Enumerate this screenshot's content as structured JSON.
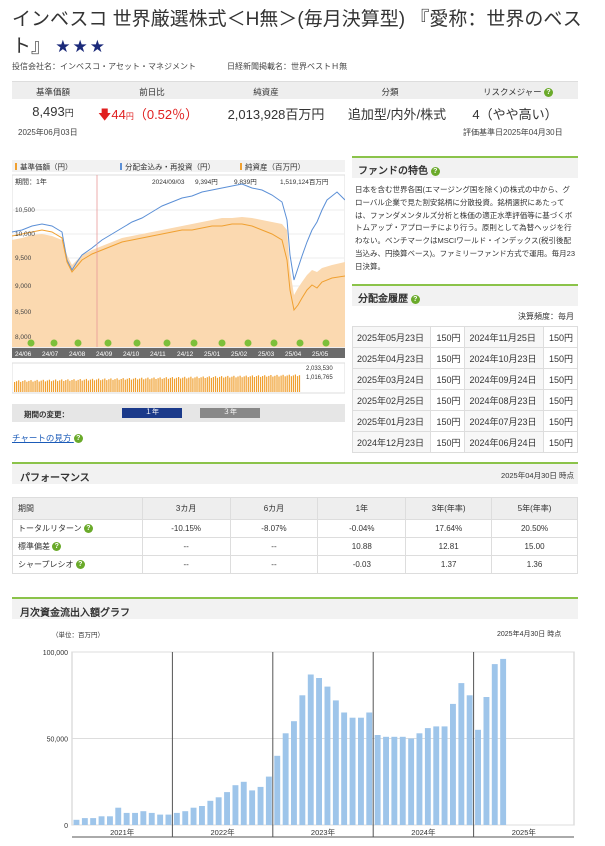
{
  "fund": {
    "title": "インベスコ 世界厳選株式＜H無＞(毎月決算型) 『愛称：世界のベスト』",
    "stars": "★★★",
    "company": "投信会社名：インベスコ・アセット・マネジメント",
    "nikkei_name": "日経新聞掲載名：世界ベストＨ無"
  },
  "summary": {
    "headers": [
      "基準価額",
      "前日比",
      "純資産",
      "分類",
      "リスクメジャー"
    ],
    "nav": "8,493",
    "nav_unit": "円",
    "change": "44",
    "change_unit": "円",
    "change_pct": "（0.52％）",
    "assets": "2,013,928百万円",
    "category": "追加型/内外/株式",
    "risk": "4（やや高い）",
    "nav_date": "2025年06月03日",
    "risk_date": "評価基準日2025年04月30日"
  },
  "price_chart": {
    "legend": [
      "基準価額（円）",
      "分配金込み・再投資（円）",
      "純資産（百万円）"
    ],
    "period_label": "期間：1年",
    "cursor_date": "2024/09/03",
    "cursor_values": [
      "9,394円",
      "9,839円",
      "1,519,124百万円"
    ],
    "y_labels": [
      "10,500",
      "10,000",
      "9,500",
      "9,000",
      "8,500",
      "8,000"
    ],
    "x_labels": [
      "24/06",
      "24/07",
      "24/08",
      "24/09",
      "24/10",
      "24/11",
      "24/12",
      "25/01",
      "25/02",
      "25/03",
      "25/04",
      "25/05"
    ],
    "volume_labels": [
      "2,033,530",
      "1,016,765"
    ],
    "period_change_label": "期間の変更：",
    "period_buttons": [
      "１年",
      "３年"
    ],
    "howto_link": "チャートの見方"
  },
  "features": {
    "title": "ファンドの特色",
    "text": "日本を含む世界各国(エマージング国を除く)の株式の中から、グローバル企業で見た割安銘柄に分散投資。銘柄選択にあたっては、ファンダメンタルズ分析と株価の適正水準評価等に基づくボトムアップ・アプローチにより行う。原則として為替ヘッジを行わない。ベンチマークはMSCIワールド・インデックス(税引後配当込み、円換算ベース)。ファミリーファンド方式で運用。毎月23日決算。"
  },
  "dividends": {
    "title": "分配金履歴",
    "frequency": "決算頻度：毎月",
    "rows": [
      [
        "2025年05月23日",
        "150円",
        "2024年11月25日",
        "150円"
      ],
      [
        "2025年04月23日",
        "150円",
        "2024年10月23日",
        "150円"
      ],
      [
        "2025年03月24日",
        "150円",
        "2024年09月24日",
        "150円"
      ],
      [
        "2025年02月25日",
        "150円",
        "2024年08月23日",
        "150円"
      ],
      [
        "2025年01月23日",
        "150円",
        "2024年07月23日",
        "150円"
      ],
      [
        "2024年12月23日",
        "150円",
        "2024年06月24日",
        "150円"
      ]
    ]
  },
  "performance": {
    "title": "パフォーマンス",
    "date": "2025年04月30日 時点",
    "headers": [
      "期間",
      "3カ月",
      "6カ月",
      "1年",
      "3年(年率)",
      "5年(年率)"
    ],
    "rows": [
      [
        "トータルリターン",
        "-10.15%",
        "-8.07%",
        "-0.04%",
        "17.64%",
        "20.50%"
      ],
      [
        "標準偏差",
        "--",
        "--",
        "10.88",
        "12.81",
        "15.00"
      ],
      [
        "シャープレシオ",
        "--",
        "--",
        "-0.03",
        "1.37",
        "1.36"
      ]
    ]
  },
  "flow_chart": {
    "title": "月次資金流出入額グラフ",
    "unit": "（単位：百万円）",
    "date": "2025年4月30日 時点",
    "y_ticks": [
      "100,000",
      "50,000",
      "0"
    ],
    "years": [
      "2021年",
      "2022年",
      "2023年",
      "2024年",
      "2025年"
    ]
  },
  "chart_data": {
    "type": "bar",
    "title": "月次資金流出入額グラフ",
    "ylabel": "（単位：百万円）",
    "ylim": [
      0,
      100000
    ],
    "categories": [
      "2021年",
      "2022年",
      "2023年",
      "2024年",
      "2025年"
    ],
    "series": [
      {
        "values": [
          3000,
          4000,
          4000,
          5000,
          5000,
          10000,
          7000,
          7000,
          8000,
          7000,
          6000,
          6000,
          7000,
          8000,
          10000,
          11000,
          14000,
          16000,
          19000,
          23000,
          25000,
          20000,
          22000,
          28000,
          40000,
          53000,
          60000,
          75000,
          87000,
          85000,
          80000,
          72000,
          65000,
          62000,
          62000,
          65000,
          52000,
          51000,
          51000,
          51000,
          50000,
          53000,
          56000,
          57000,
          57000,
          70000,
          82000,
          75000,
          55000,
          74000,
          93000,
          96000
        ]
      }
    ]
  }
}
